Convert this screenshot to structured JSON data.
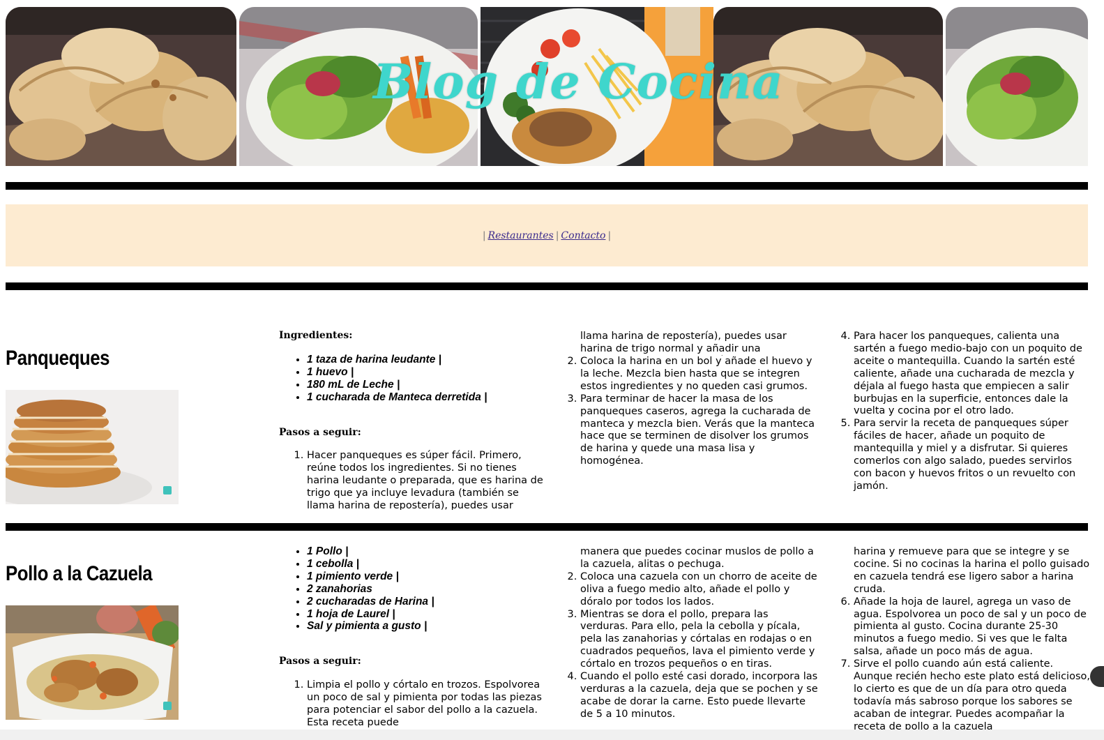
{
  "header": {
    "title": "Blog de Cocina",
    "tiles": [
      "empanadas-photo",
      "salad-plate-photo",
      "osobuco-plate-photo",
      "empanadas-photo",
      "salad-plate-photo"
    ]
  },
  "nav": {
    "sep": "|",
    "links": [
      "Restaurantes",
      "Contacto"
    ]
  },
  "recipes": [
    {
      "title": "Panqueques",
      "image": "pancakes-photo",
      "ingredients_label": "Ingredientes:",
      "ingredients": [
        "1 taza de harina leudante |",
        "1 huevo |",
        "180 mL de Leche |",
        "1 cucharada de Manteca derretida |"
      ],
      "steps_label": "Pasos a seguir:",
      "steps": [
        "Hacer panqueques es súper fácil. Primero, reúne todos los ingredientes. Si no tienes harina leudante o preparada, que es harina de trigo que ya incluye levadura (también se llama harina de repostería), puedes usar harina de trigo normal y añadir una cucharadita de levadura química en polvo (polvo de hornear).",
        "Coloca la harina en un bol y añade el huevo y la leche. Mezcla bien hasta que se integren estos ingredientes y no queden casi grumos.",
        "Para terminar de hacer la masa de los panqueques caseros, agrega la cucharada de manteca y mezcla bien. Verás que la manteca hace que se terminen de disolver los grumos de harina y quede una masa lisa y homogénea.",
        "Para hacer los panqueques, calienta una sartén a fuego medio-bajo con un poquito de aceite o mantequilla. Cuando la sartén esté caliente, añade una cucharada de mezcla y déjala al fuego hasta que empiecen a salir burbujas en la superficie, entonces dale la vuelta y cocina por el otro lado.",
        "Para servir la receta de panqueques súper fáciles de hacer, añade un poquito de mantequilla y miel y a disfrutar. Si quieres comerlos con algo salado, puedes servirlos con bacon y huevos fritos o un revuelto con jamón."
      ]
    },
    {
      "title": "Pollo a la Cazuela",
      "image": "chicken-stew-photo",
      "ingredients": [
        "1 Pollo |",
        "1 cebolla |",
        "1 pimiento verde |",
        "2 zanahorias",
        "2 cucharadas de Harina |",
        "1 hoja de Laurel |",
        "Sal y pimienta a gusto |"
      ],
      "steps_label": "Pasos a seguir:",
      "steps": [
        "Limpia el pollo y córtalo en trozos. Espolvorea un poco de sal y pimienta por todas las piezas para potenciar el sabor del pollo a la cazuela. Esta receta puede",
        "manera que puedes cocinar muslos de pollo a la cazuela, alitas o pechuga.",
        "Coloca una cazuela con un chorro de aceite de oliva a fuego medio alto, añade el pollo y dóralo por todos los lados.",
        "Mientras se dora el pollo, prepara las verduras. Para ello, pela la cebolla y pícala, pela las zanahorias y córtalas en rodajas o en cuadrados pequeños, lava el pimiento verde y córtalo en trozos pequeños o en tiras.",
        "Cuando el pollo esté casi dorado, incorpora las verduras a la cazuela, deja que se pochen y se acabe de dorar la carne. Esto puede llevarte de 5 a 10 minutos.",
        "harina y remueve para que se integre y se cocine. Si no cocinas la harina el pollo guisado en cazuela tendrá ese ligero sabor a harina cruda.",
        "Añade la hoja de laurel, agrega un vaso de agua. Espolvorea un poco de sal y un poco de pimienta al gusto. Cocina durante 25-30 minutos a fuego medio. Si ves que le falta salsa, añade un poco más de agua.",
        "Sirve el pollo cuando aún está caliente. Aunque recién hecho este plato está delicioso, lo cierto es que de un día para otro queda todavía más sabroso porque los sabores se acaban de integrar. Puedes acompañar la receta de pollo a la cazuela"
      ]
    }
  ]
}
